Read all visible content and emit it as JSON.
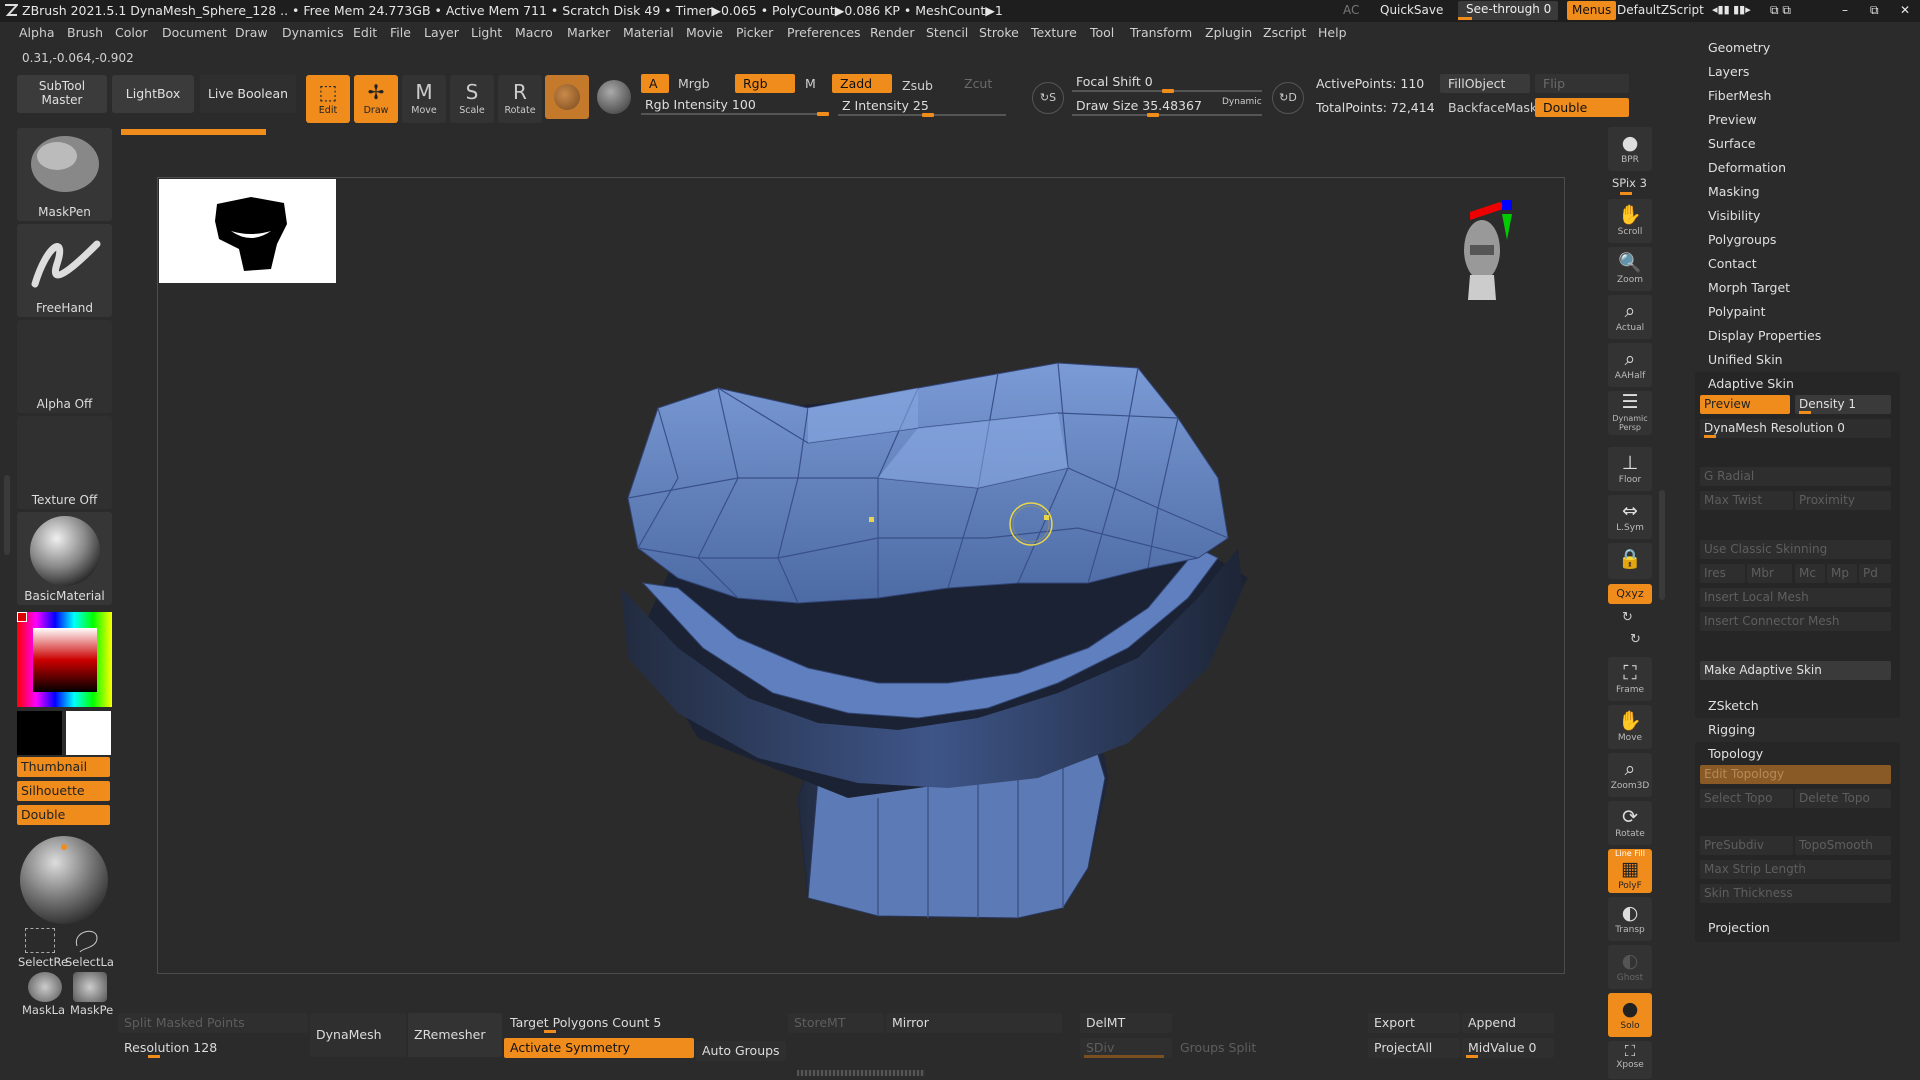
{
  "titlebar": {
    "title": "ZBrush 2021.5.1   DynaMesh_Sphere_128   .. • Free Mem 24.773GB • Active Mem 711 • Scratch Disk 49 • Timer▶0.065 • PolyCount▶0.086 KP • MeshCount▶1",
    "ac": "AC",
    "quicksave": "QuickSave",
    "see_through": "See-through  0",
    "menus": "Menus",
    "default_zscript": "DefaultZScript"
  },
  "menu": [
    "Alpha",
    "Brush",
    "Color",
    "Document",
    "Draw",
    "Dynamics",
    "Edit",
    "File",
    "Layer",
    "Light",
    "Macro",
    "Marker",
    "Material",
    "Movie",
    "Picker",
    "Preferences",
    "Render",
    "Stencil",
    "Stroke",
    "Texture",
    "Tool",
    "Transform",
    "Zplugin",
    "Zscript",
    "Help"
  ],
  "coords": "0.31,-0.064,-0.902",
  "toolbar": {
    "subtool_master": "SubTool\nMaster",
    "lightbox": "LightBox",
    "live_boolean": "Live Boolean",
    "edit": "Edit",
    "draw": "Draw",
    "move": "Move",
    "scale": "Scale",
    "rotate": "Rotate",
    "a": "A",
    "mrgb": "Mrgb",
    "rgb": "Rgb",
    "m": "M",
    "zadd": "Zadd",
    "zsub": "Zsub",
    "zcut": "Zcut",
    "rgb_intensity": "Rgb Intensity 100",
    "z_intensity": "Z Intensity 25",
    "focal_shift": "Focal Shift 0",
    "draw_size": "Draw Size 35.48367",
    "dynamic": "Dynamic",
    "active_points": "ActivePoints: 110",
    "total_points": "TotalPoints: 72,414",
    "fill_object": "FillObject",
    "flip": "Flip",
    "backface_mask": "BackfaceMask",
    "double": "Double"
  },
  "left": {
    "maskpen": "MaskPen",
    "freehand": "FreeHand",
    "alpha_off": "Alpha Off",
    "texture_off": "Texture Off",
    "basic_material": "BasicMaterial",
    "thumbnail": "Thumbnail",
    "silhouette": "Silhouette",
    "double": "Double",
    "select_rect": "SelectRe",
    "select_lasso": "SelectLa",
    "mask_lasso": "MaskLa",
    "mask_pen": "MaskPe"
  },
  "right_icons": {
    "bpr": "BPR",
    "spix": "SPix 3",
    "scroll": "Scroll",
    "zoom": "Zoom",
    "actual": "Actual",
    "aahalf": "AAHalf",
    "dynamic_persp": "Dynamic\nPersp",
    "floor": "Floor",
    "lsym": "L.Sym",
    "xyz": "Qxyz",
    "frame": "Frame",
    "move": "Move",
    "zoom3d": "Zoom3D",
    "rotate": "Rotate",
    "polyf": "PolyF",
    "line_fill": "Line Fill",
    "transp": "Transp",
    "ghost": "Ghost",
    "solo": "Solo",
    "xpose": "Xpose"
  },
  "right_panel": {
    "items_top": [
      "Geometry",
      "Layers",
      "FiberMesh",
      "Preview",
      "Surface",
      "Deformation",
      "Masking",
      "Visibility",
      "Polygroups",
      "Contact",
      "Morph Target",
      "Polypaint",
      "Display Properties",
      "Unified Skin"
    ],
    "adaptive_skin": "Adaptive Skin",
    "preview": "Preview",
    "density": "Density 1",
    "dynamesh_resolution": "DynaMesh Resolution 0",
    "g_radial": "G Radial",
    "max_twist": "Max Twist",
    "proximity": "Proximity",
    "use_classic_skinning": "Use Classic Skinning",
    "ires": "Ires",
    "mbr": "Mbr",
    "mc": "Mc",
    "mp": "Mp",
    "pd": "Pd",
    "insert_local_mesh": "Insert Local Mesh",
    "insert_connector_mesh": "Insert Connector Mesh",
    "make_adaptive_skin": "Make Adaptive Skin",
    "zsketch": "ZSketch",
    "rigging": "Rigging",
    "topology": "Topology",
    "edit_topology": "Edit Topology",
    "select_topo": "Select Topo",
    "delete_topo": "Delete Topo",
    "presubdiv": "PreSubdiv",
    "toposmooth": "TopoSmooth",
    "max_strip_length": "Max Strip Length",
    "skin_thickness": "Skin Thickness",
    "projection": "Projection"
  },
  "bottom": {
    "split_masked_points": "Split Masked Points",
    "resolution": "Resolution 128",
    "dynamesh": "DynaMesh",
    "zremesher": "ZRemesher",
    "target_polygons": "Target Polygons Count 5",
    "activate_symmetry": "Activate Symmetry",
    "auto_groups": "Auto Groups",
    "storemt": "StoreMT",
    "mirror": "Mirror",
    "delmt": "DelMT",
    "sdiv": "SDiv",
    "groups_split": "Groups Split",
    "export": "Export",
    "append": "Append",
    "projectall": "ProjectAll",
    "midvalue": "MidValue 0"
  },
  "colors": {
    "accent": "#f08c1c",
    "bg": "#2b2b2b",
    "mesh": "#6f8ec7"
  }
}
